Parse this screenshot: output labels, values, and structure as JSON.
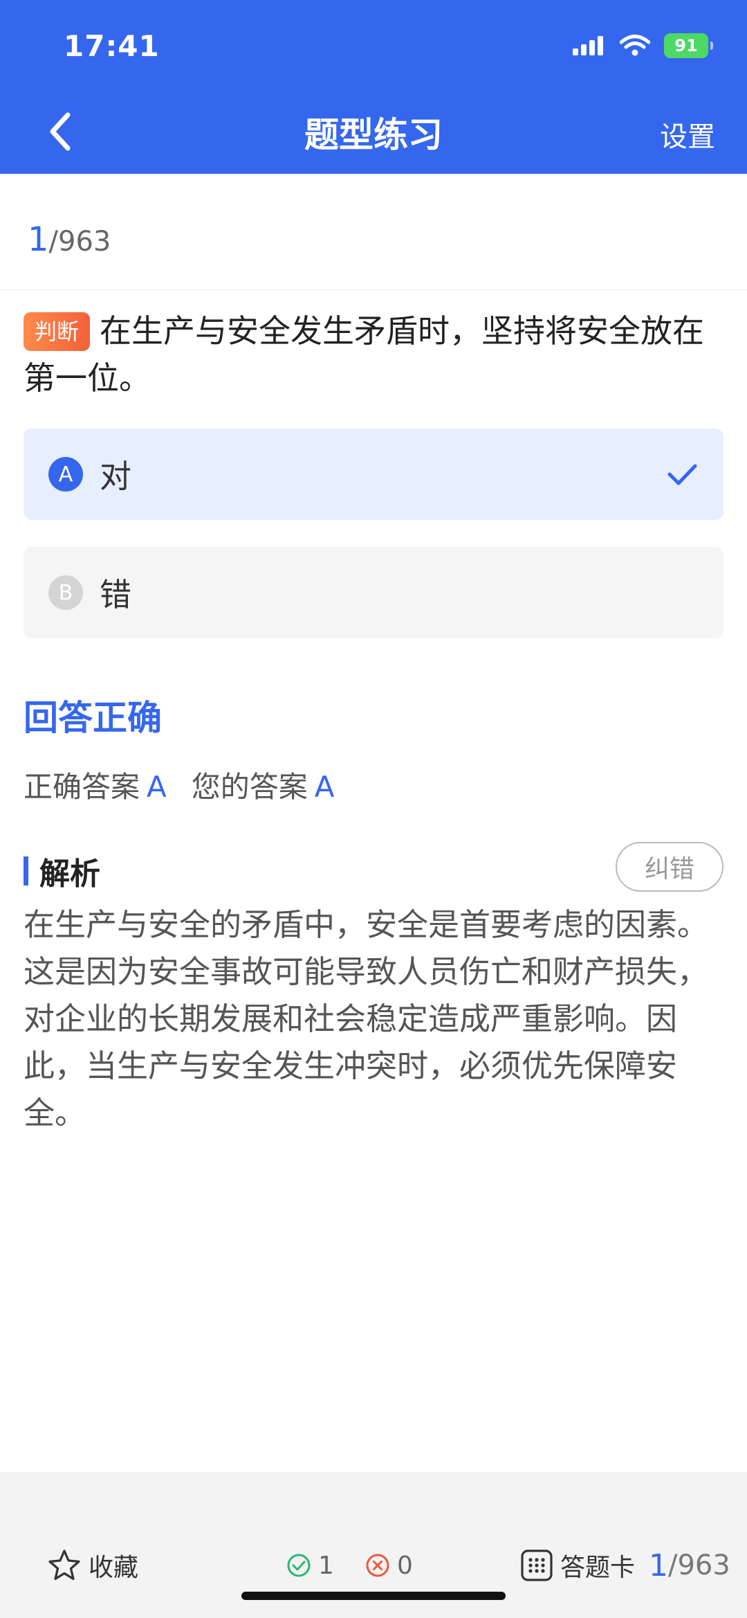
{
  "status_bar": {
    "time": "17:41",
    "battery": "91",
    "icons": [
      "signal-icon",
      "wifi-icon",
      "battery-icon"
    ]
  },
  "nav": {
    "back_icon": "chevron-left-icon",
    "title": "题型练习",
    "settings_label": "设置"
  },
  "progress": {
    "current": "1",
    "total": "/963"
  },
  "question": {
    "type_badge": "判断",
    "text": "在生产与安全发生矛盾时，坚持将安全放在第一位。",
    "options": [
      {
        "letter": "A",
        "text": "对",
        "selected": true
      },
      {
        "letter": "B",
        "text": "错",
        "selected": false
      }
    ]
  },
  "result": {
    "title": "回答正确",
    "correct_label": "正确答案",
    "correct_value": "A",
    "yours_label": "您的答案",
    "yours_value": "A"
  },
  "analysis": {
    "title": "解析",
    "report_button": "纠错",
    "text": "在生产与安全的矛盾中，安全是首要考虑的因素。这是因为安全事故可能导致人员伤亡和财产损失，对企业的长期发展和社会稳定造成严重影响。因此，当生产与安全发生冲突时，必须优先保障安全。"
  },
  "bottom_bar": {
    "favorite_label": "收藏",
    "right_count": "1",
    "wrong_count": "0",
    "answer_card_label": "答题卡",
    "progress_current": "1",
    "progress_total": "/963"
  },
  "colors": {
    "primary": "#3567EE",
    "badge_orange": "#F3613A",
    "selected_bg": "#E7EEFD",
    "correct_green": "#2BB673",
    "wrong_red": "#F0553F"
  }
}
